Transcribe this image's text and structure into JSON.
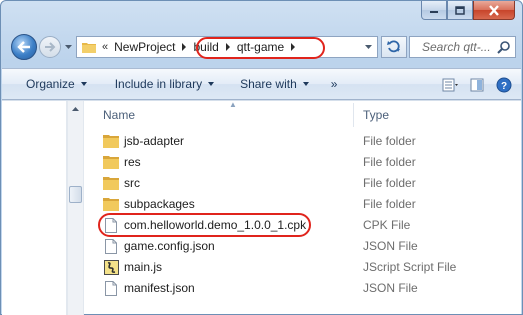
{
  "window": {
    "caption_buttons": [
      "minimize",
      "maximize",
      "close"
    ]
  },
  "address_bar": {
    "prefix": "«",
    "crumbs": [
      "NewProject",
      "build",
      "qtt-game"
    ],
    "highlighted_crumbs": [
      "build",
      "qtt-game"
    ]
  },
  "search": {
    "placeholder": "Search qtt-..."
  },
  "toolbar": {
    "organize": "Organize",
    "include_in_library": "Include in library",
    "share_with": "Share with",
    "more": "»"
  },
  "columns": {
    "name": "Name",
    "type": "Type"
  },
  "files": [
    {
      "name": "jsb-adapter",
      "type": "File folder",
      "icon": "folder-icon"
    },
    {
      "name": "res",
      "type": "File folder",
      "icon": "folder-icon"
    },
    {
      "name": "src",
      "type": "File folder",
      "icon": "folder-icon"
    },
    {
      "name": "subpackages",
      "type": "File folder",
      "icon": "folder-icon"
    },
    {
      "name": "com.helloworld.demo_1.0.0_1.cpk",
      "type": "CPK File",
      "icon": "file-icon",
      "highlighted": true
    },
    {
      "name": "game.config.json",
      "type": "JSON File",
      "icon": "file-icon"
    },
    {
      "name": "main.js",
      "type": "JScript Script File",
      "icon": "jscript-file-icon"
    },
    {
      "name": "manifest.json",
      "type": "JSON File",
      "icon": "file-icon"
    }
  ],
  "colors": {
    "highlight_ring": "#e0241c",
    "folder": "#e8b949"
  }
}
